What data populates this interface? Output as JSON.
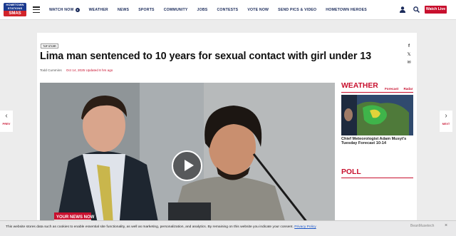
{
  "brand": {
    "logo_top": "HOMETOWN STATIONS",
    "logo_bottom": "SMAS"
  },
  "nav": {
    "items": [
      "WATCH NOW",
      "WEATHER",
      "NEWS",
      "SPORTS",
      "COMMUNITY",
      "JOBS",
      "CONTESTS",
      "VOTE NOW",
      "SEND PICS & VIDEO",
      "HOMETOWN HEROES"
    ],
    "watch_live": "Watch Live"
  },
  "pager": {
    "prev": "PREV",
    "next": "NEXT"
  },
  "article": {
    "badge": "TOP STORY",
    "headline": "Lima man sentenced to 10 years for sexual contact with girl under 13",
    "author": "Todd Cummins",
    "date": "Oct 14, 2025 Updated 8 hrs ago",
    "video_overlay": "YOUR NEWS NOW"
  },
  "sidebar": {
    "weather_title": "WEATHER",
    "weather_links": [
      "Forecast",
      "Radar"
    ],
    "weather_caption": "Chief Meteorologist Adam Musyt's Tuesday Forecast 10-14",
    "poll_title": "POLL"
  },
  "cookie": {
    "text": "This website stores data such as cookies to enable essential site functionality, as well as marketing, personalization, and analytics. By remaining on this website you indicate your consent.",
    "policy": "Privacy Policy",
    "brand": "BeanMusetech",
    "close": "×"
  }
}
